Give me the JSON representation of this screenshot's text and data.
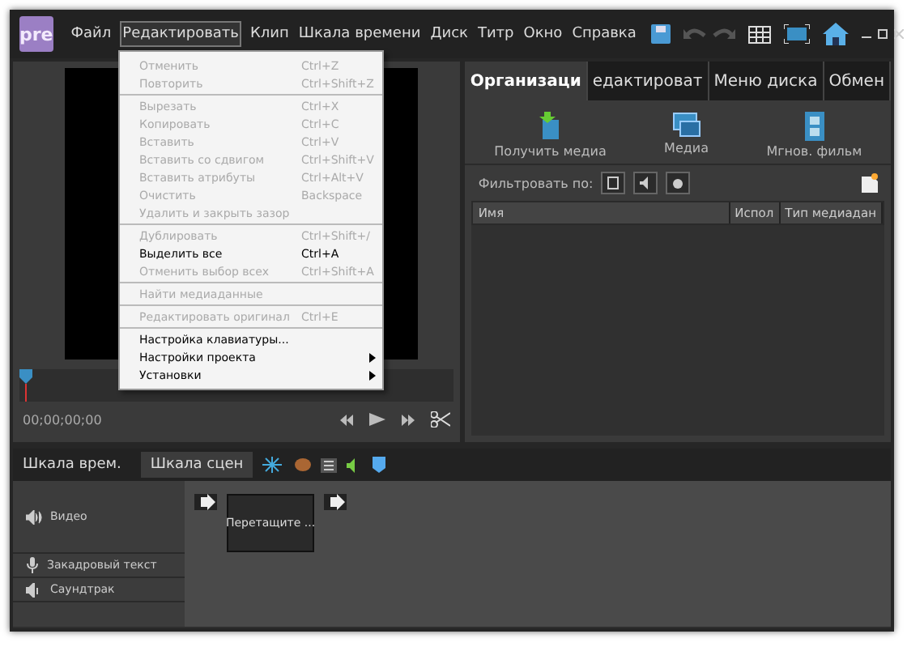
{
  "app": {
    "logo": "pre"
  },
  "menu": [
    {
      "label": "Файл",
      "selected": false
    },
    {
      "label": "Редактировать",
      "selected": true
    },
    {
      "label": "Клип",
      "selected": false
    },
    {
      "label": "Шкала времени",
      "selected": false
    },
    {
      "label": "Диск",
      "selected": false
    },
    {
      "label": "Титр",
      "selected": false
    },
    {
      "label": "Окно",
      "selected": false
    },
    {
      "label": "Справка",
      "selected": false
    }
  ],
  "dropdown": [
    [
      {
        "label": "Отменить",
        "shortcut": "Ctrl+Z",
        "disabled": true,
        "kind": "item"
      },
      {
        "label": "Повторить",
        "shortcut": "Ctrl+Shift+Z",
        "disabled": true,
        "kind": "item"
      }
    ],
    [
      {
        "label": "Вырезать",
        "shortcut": "Ctrl+X",
        "disabled": true,
        "kind": "item"
      },
      {
        "label": "Копировать",
        "shortcut": "Ctrl+C",
        "disabled": true,
        "kind": "item"
      },
      {
        "label": "Вставить",
        "shortcut": "Ctrl+V",
        "disabled": true,
        "kind": "item"
      },
      {
        "label": "Вставить со сдвигом",
        "shortcut": "Ctrl+Shift+V",
        "disabled": true,
        "kind": "item"
      },
      {
        "label": "Вставить атрибуты",
        "shortcut": "Ctrl+Alt+V",
        "disabled": true,
        "kind": "item"
      },
      {
        "label": "Очистить",
        "shortcut": "Backspace",
        "disabled": true,
        "kind": "item"
      },
      {
        "label": "Удалить и закрыть зазор",
        "disabled": true,
        "kind": "item"
      }
    ],
    [
      {
        "label": "Дублировать",
        "shortcut": "Ctrl+Shift+/",
        "disabled": true,
        "kind": "item"
      },
      {
        "label": "Выделить все",
        "shortcut": "Ctrl+A",
        "disabled": false,
        "kind": "item"
      },
      {
        "label": "Отменить выбор всех",
        "shortcut": "Ctrl+Shift+A",
        "disabled": true,
        "kind": "item"
      }
    ],
    [
      {
        "label": "Найти медиаданные",
        "disabled": true,
        "kind": "item"
      }
    ],
    [
      {
        "label": "Редактировать оригинал",
        "shortcut": "Ctrl+E",
        "disabled": true,
        "kind": "item"
      }
    ],
    [
      {
        "label": "Настройка клавиатуры...",
        "disabled": false,
        "kind": "item"
      },
      {
        "label": "Настройки проекта",
        "disabled": false,
        "kind": "submenu"
      },
      {
        "label": "Установки",
        "disabled": false,
        "kind": "submenu"
      }
    ]
  ],
  "monitor": {
    "timecode": "00;00;00;00"
  },
  "right_panel": {
    "tabs": [
      {
        "label": "Организаци",
        "selected": true
      },
      {
        "label": "едактироват",
        "selected": false
      },
      {
        "label": "Меню диска",
        "selected": false
      },
      {
        "label": "Обмен",
        "selected": false
      }
    ],
    "actions": [
      {
        "label": "Получить медиа",
        "kind": "get"
      },
      {
        "label": "Медиа",
        "kind": "media"
      },
      {
        "label": "Мгнов. фильм",
        "kind": "film"
      }
    ],
    "filter_label": "Фильтровать по:",
    "columns": [
      "Имя",
      "Испол",
      "Тип медиадан"
    ]
  },
  "timeline": {
    "tabs": [
      {
        "label": "Шкала врем.",
        "selected": false
      },
      {
        "label": "Шкала сцен",
        "selected": true
      }
    ],
    "tracks": [
      {
        "label": "Видео",
        "kind": "video"
      },
      {
        "label": "Закадровый текст",
        "kind": "narration"
      },
      {
        "label": "Саундтрак",
        "kind": "soundtrack"
      }
    ],
    "scene_placeholder": "Перетащите ..."
  }
}
